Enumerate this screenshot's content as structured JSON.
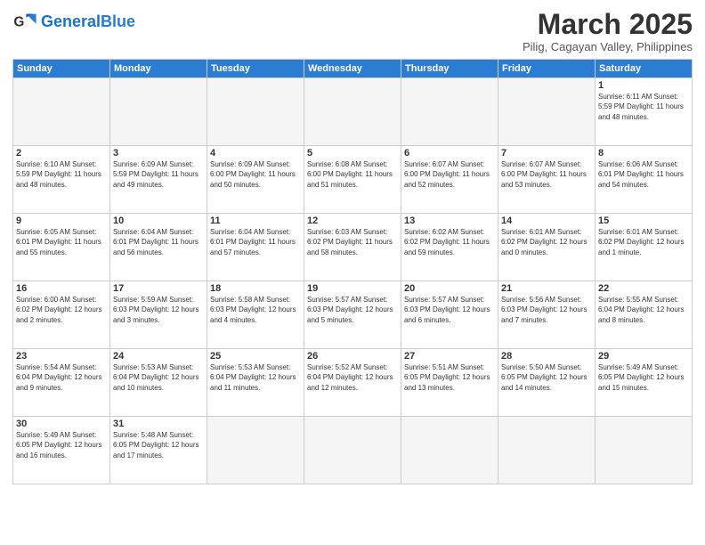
{
  "header": {
    "logo_general": "General",
    "logo_blue": "Blue",
    "month_title": "March 2025",
    "subtitle": "Pilig, Cagayan Valley, Philippines"
  },
  "days_of_week": [
    "Sunday",
    "Monday",
    "Tuesday",
    "Wednesday",
    "Thursday",
    "Friday",
    "Saturday"
  ],
  "weeks": [
    [
      {
        "day": "",
        "info": ""
      },
      {
        "day": "",
        "info": ""
      },
      {
        "day": "",
        "info": ""
      },
      {
        "day": "",
        "info": ""
      },
      {
        "day": "",
        "info": ""
      },
      {
        "day": "",
        "info": ""
      },
      {
        "day": "1",
        "info": "Sunrise: 6:11 AM\nSunset: 5:59 PM\nDaylight: 11 hours and 48 minutes."
      }
    ],
    [
      {
        "day": "2",
        "info": "Sunrise: 6:10 AM\nSunset: 5:59 PM\nDaylight: 11 hours and 48 minutes."
      },
      {
        "day": "3",
        "info": "Sunrise: 6:09 AM\nSunset: 5:59 PM\nDaylight: 11 hours and 49 minutes."
      },
      {
        "day": "4",
        "info": "Sunrise: 6:09 AM\nSunset: 6:00 PM\nDaylight: 11 hours and 50 minutes."
      },
      {
        "day": "5",
        "info": "Sunrise: 6:08 AM\nSunset: 6:00 PM\nDaylight: 11 hours and 51 minutes."
      },
      {
        "day": "6",
        "info": "Sunrise: 6:07 AM\nSunset: 6:00 PM\nDaylight: 11 hours and 52 minutes."
      },
      {
        "day": "7",
        "info": "Sunrise: 6:07 AM\nSunset: 6:00 PM\nDaylight: 11 hours and 53 minutes."
      },
      {
        "day": "8",
        "info": "Sunrise: 6:06 AM\nSunset: 6:01 PM\nDaylight: 11 hours and 54 minutes."
      }
    ],
    [
      {
        "day": "9",
        "info": "Sunrise: 6:05 AM\nSunset: 6:01 PM\nDaylight: 11 hours and 55 minutes."
      },
      {
        "day": "10",
        "info": "Sunrise: 6:04 AM\nSunset: 6:01 PM\nDaylight: 11 hours and 56 minutes."
      },
      {
        "day": "11",
        "info": "Sunrise: 6:04 AM\nSunset: 6:01 PM\nDaylight: 11 hours and 57 minutes."
      },
      {
        "day": "12",
        "info": "Sunrise: 6:03 AM\nSunset: 6:02 PM\nDaylight: 11 hours and 58 minutes."
      },
      {
        "day": "13",
        "info": "Sunrise: 6:02 AM\nSunset: 6:02 PM\nDaylight: 11 hours and 59 minutes."
      },
      {
        "day": "14",
        "info": "Sunrise: 6:01 AM\nSunset: 6:02 PM\nDaylight: 12 hours and 0 minutes."
      },
      {
        "day": "15",
        "info": "Sunrise: 6:01 AM\nSunset: 6:02 PM\nDaylight: 12 hours and 1 minute."
      }
    ],
    [
      {
        "day": "16",
        "info": "Sunrise: 6:00 AM\nSunset: 6:02 PM\nDaylight: 12 hours and 2 minutes."
      },
      {
        "day": "17",
        "info": "Sunrise: 5:59 AM\nSunset: 6:03 PM\nDaylight: 12 hours and 3 minutes."
      },
      {
        "day": "18",
        "info": "Sunrise: 5:58 AM\nSunset: 6:03 PM\nDaylight: 12 hours and 4 minutes."
      },
      {
        "day": "19",
        "info": "Sunrise: 5:57 AM\nSunset: 6:03 PM\nDaylight: 12 hours and 5 minutes."
      },
      {
        "day": "20",
        "info": "Sunrise: 5:57 AM\nSunset: 6:03 PM\nDaylight: 12 hours and 6 minutes."
      },
      {
        "day": "21",
        "info": "Sunrise: 5:56 AM\nSunset: 6:03 PM\nDaylight: 12 hours and 7 minutes."
      },
      {
        "day": "22",
        "info": "Sunrise: 5:55 AM\nSunset: 6:04 PM\nDaylight: 12 hours and 8 minutes."
      }
    ],
    [
      {
        "day": "23",
        "info": "Sunrise: 5:54 AM\nSunset: 6:04 PM\nDaylight: 12 hours and 9 minutes."
      },
      {
        "day": "24",
        "info": "Sunrise: 5:53 AM\nSunset: 6:04 PM\nDaylight: 12 hours and 10 minutes."
      },
      {
        "day": "25",
        "info": "Sunrise: 5:53 AM\nSunset: 6:04 PM\nDaylight: 12 hours and 11 minutes."
      },
      {
        "day": "26",
        "info": "Sunrise: 5:52 AM\nSunset: 6:04 PM\nDaylight: 12 hours and 12 minutes."
      },
      {
        "day": "27",
        "info": "Sunrise: 5:51 AM\nSunset: 6:05 PM\nDaylight: 12 hours and 13 minutes."
      },
      {
        "day": "28",
        "info": "Sunrise: 5:50 AM\nSunset: 6:05 PM\nDaylight: 12 hours and 14 minutes."
      },
      {
        "day": "29",
        "info": "Sunrise: 5:49 AM\nSunset: 6:05 PM\nDaylight: 12 hours and 15 minutes."
      }
    ],
    [
      {
        "day": "30",
        "info": "Sunrise: 5:49 AM\nSunset: 6:05 PM\nDaylight: 12 hours and 16 minutes."
      },
      {
        "day": "31",
        "info": "Sunrise: 5:48 AM\nSunset: 6:05 PM\nDaylight: 12 hours and 17 minutes."
      },
      {
        "day": "",
        "info": ""
      },
      {
        "day": "",
        "info": ""
      },
      {
        "day": "",
        "info": ""
      },
      {
        "day": "",
        "info": ""
      },
      {
        "day": "",
        "info": ""
      }
    ]
  ]
}
